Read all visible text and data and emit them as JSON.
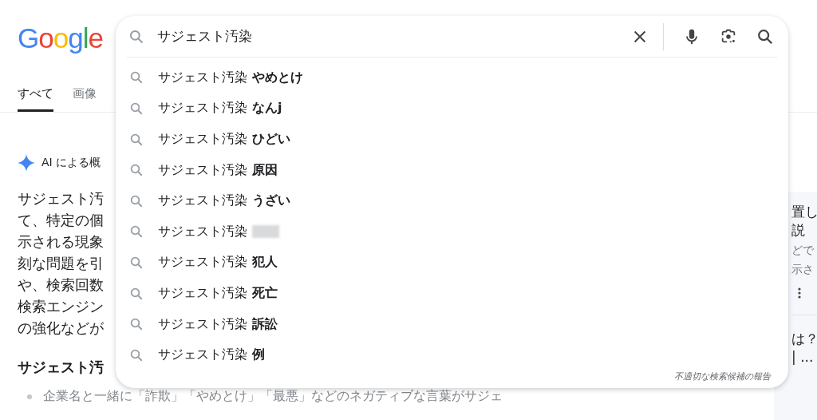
{
  "logo": "Google",
  "tabs": [
    {
      "label": "すべて",
      "selected": true
    },
    {
      "label": "画像",
      "selected": false
    }
  ],
  "ai_overview": {
    "label": "AI による概",
    "lines": [
      "サジェスト汚",
      "て、特定の個",
      "示される現象",
      "刻な問題を引",
      "や、検索回数",
      "検索エンジン",
      "の強化などが"
    ],
    "heading": "サジェスト汚",
    "bullet": "企業名と一緒に「詐欺」「やめとけ」「最悪」などのネガティブな言葉がサジェ"
  },
  "side_panel": {
    "title_1": [
      "置し",
      "説"
    ],
    "snippet_1": [
      "どで",
      "示さ"
    ],
    "title_2": [
      "は？",
      "| ..."
    ]
  },
  "search": {
    "value": "サジェスト汚染",
    "report_link": "不適切な検索候補の報告"
  },
  "suggestions": [
    {
      "kind": "text",
      "prefix": "サジェスト汚染",
      "suffix": "やめとけ"
    },
    {
      "kind": "text",
      "prefix": "サジェスト汚染",
      "suffix": "なんj"
    },
    {
      "kind": "text",
      "prefix": "サジェスト汚染",
      "suffix": "ひどい"
    },
    {
      "kind": "text",
      "prefix": "サジェスト汚染",
      "suffix": "原因"
    },
    {
      "kind": "text",
      "prefix": "サジェスト汚染",
      "suffix": "うざい"
    },
    {
      "kind": "blurred",
      "prefix": "サジェスト汚染"
    },
    {
      "kind": "text",
      "prefix": "サジェスト汚染",
      "suffix": "犯人"
    },
    {
      "kind": "text",
      "prefix": "サジェスト汚染",
      "suffix": "死亡"
    },
    {
      "kind": "text",
      "prefix": "サジェスト汚染",
      "suffix": "訴訟"
    },
    {
      "kind": "text",
      "prefix": "サジェスト汚染",
      "suffix": "例"
    }
  ]
}
